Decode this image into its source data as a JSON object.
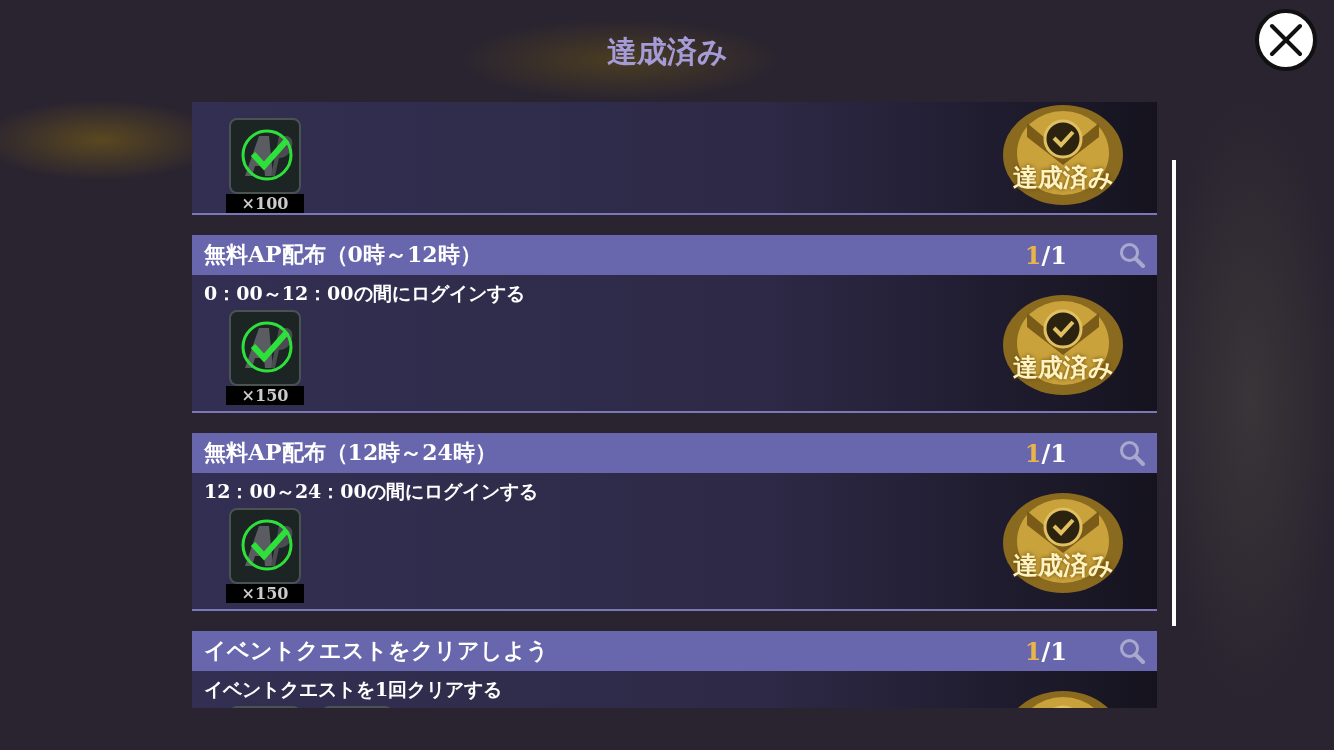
{
  "title": "達成済み",
  "missions": [
    {
      "kind": "cut_off",
      "rewards": [
        {
          "count": "×100"
        }
      ],
      "stamp": "達成済み"
    },
    {
      "kind": "full",
      "title": "無料AP配布（0時～12時）",
      "done": "1",
      "total": "/1",
      "description": "0：00～12：00の間にログインする",
      "rewards": [
        {
          "count": "×150"
        }
      ],
      "stamp": "達成済み"
    },
    {
      "kind": "full",
      "title": "無料AP配布（12時～24時）",
      "done": "1",
      "total": "/1",
      "description": "12：00～24：00の間にログインする",
      "rewards": [
        {
          "count": "×150"
        }
      ],
      "stamp": "達成済み"
    },
    {
      "kind": "full",
      "title": "イベントクエストをクリアしよう",
      "done": "1",
      "total": "/1",
      "description": "イベントクエストを1回クリアする",
      "rewards": [
        {
          "cut": true
        },
        {
          "cut": true
        }
      ]
    }
  ]
}
